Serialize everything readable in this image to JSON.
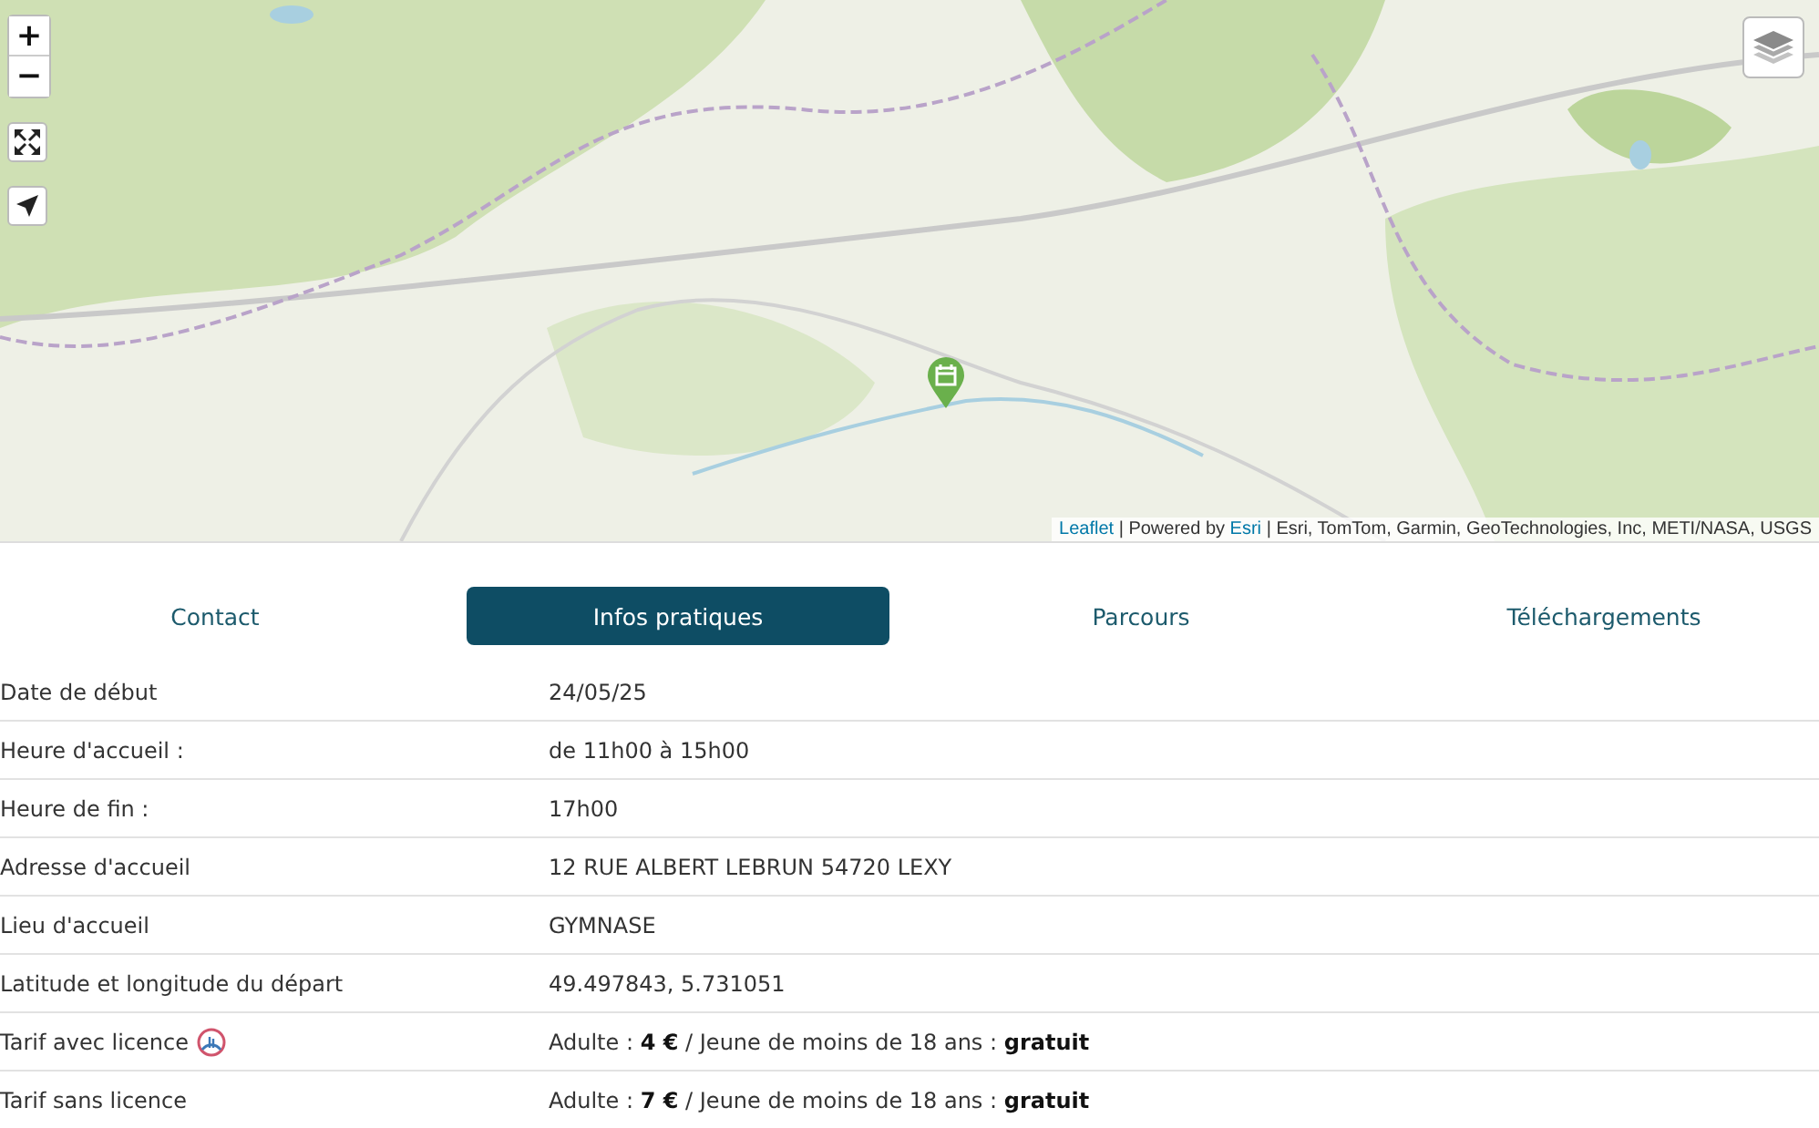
{
  "map": {
    "zoom_in": "+",
    "zoom_out": "−",
    "attribution": {
      "leaflet_link": "Leaflet",
      "powered_by": "| Powered by",
      "esri_link": "Esri",
      "sources": "| Esri, TomTom, Garmin, GeoTechnologies, Inc, METI/NASA, USGS"
    }
  },
  "tabs": [
    {
      "label": "Contact",
      "selected": false
    },
    {
      "label": "Infos pratiques",
      "selected": true
    },
    {
      "label": "Parcours",
      "selected": false
    },
    {
      "label": "Téléchargements",
      "selected": false
    }
  ],
  "rows": [
    {
      "label": "Date de début",
      "value": "24/05/25"
    },
    {
      "label": "Heure d'accueil :",
      "value": "de 11h00 à 15h00"
    },
    {
      "label": "Heure de fin :",
      "value": "17h00"
    },
    {
      "label": "Adresse d'accueil",
      "value": "12 RUE ALBERT LEBRUN 54720 LEXY"
    },
    {
      "label": "Lieu d'accueil",
      "value": "GYMNASE"
    },
    {
      "label": "Latitude et longitude du départ",
      "value": "49.497843, 5.731051"
    },
    {
      "label": "Tarif avec licence",
      "licence_icon": true,
      "value": "Adulte : **4 €** / Jeune de moins de 18 ans : **gratuit**"
    },
    {
      "label": "Tarif sans licence",
      "licence_icon": false,
      "value": "Adulte : **7 €** / Jeune de moins de 18 ans : **gratuit**"
    }
  ]
}
